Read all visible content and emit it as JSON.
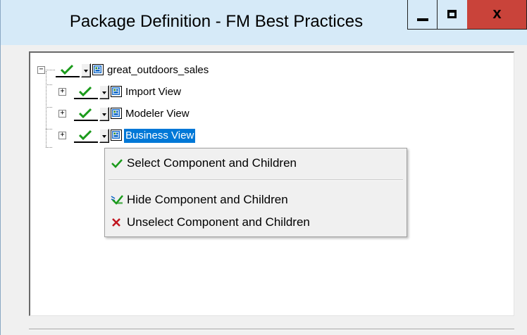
{
  "window": {
    "title": "Package Definition - FM Best Practices",
    "controls": {
      "minimize_icon": "minimize-icon",
      "maximize_icon": "maximize-icon",
      "close_label": "x"
    }
  },
  "tree": {
    "expander_collapse": "−",
    "expander_expand": "+",
    "root": {
      "label": "great_outdoors_sales",
      "expanded": true,
      "checked": true
    },
    "children": [
      {
        "label": "Import View",
        "expanded": false,
        "checked": true,
        "selected": false
      },
      {
        "label": "Modeler View",
        "expanded": false,
        "checked": true,
        "selected": false
      },
      {
        "label": "Business View",
        "expanded": false,
        "checked": true,
        "selected": true
      }
    ]
  },
  "context_menu": {
    "items": [
      {
        "label": "Select Component and Children",
        "icon": "green-check-icon"
      },
      {
        "label": "Hide Component and Children",
        "icon": "hide-component-icon"
      },
      {
        "label": "Unselect Component and Children",
        "icon": "red-x-icon"
      }
    ]
  },
  "colors": {
    "title_bar": "#d6eaf8",
    "close_button": "#c9433a",
    "selection": "#0078d7",
    "check_green": "#1a9a1a",
    "unselect_red": "#c0141e"
  }
}
